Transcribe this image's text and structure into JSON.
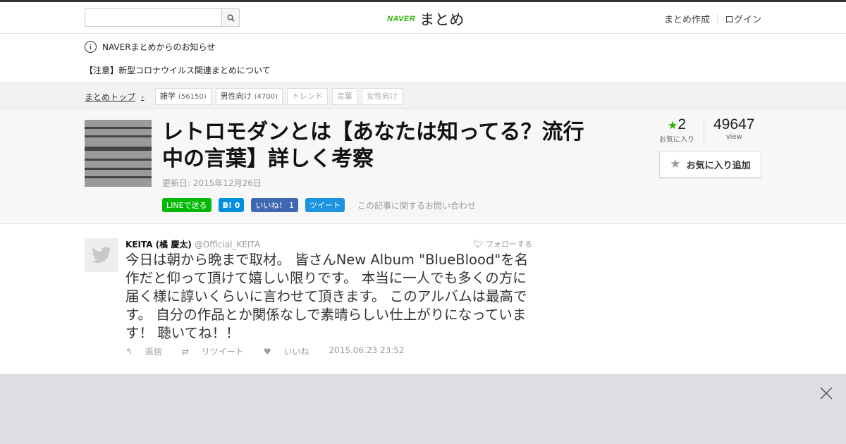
{
  "header": {
    "search_placeholder": "",
    "logo_brand": "NAVER",
    "logo_service": "まとめ",
    "nav": [
      "まとめ作成",
      "ログイン"
    ]
  },
  "notice": {
    "title": "NAVERまとめからのお知らせ",
    "item": "【注意】新型コロナウイルス関連まとめについて"
  },
  "breadcrumb": {
    "top": "まとめトップ",
    "tags": [
      {
        "label": "雑学",
        "count": "(56150)"
      },
      {
        "label": "男性向け",
        "count": "(4700)"
      },
      {
        "label": "トレンド",
        "count": ""
      },
      {
        "label": "言葉",
        "count": ""
      },
      {
        "label": "女性向け",
        "count": ""
      }
    ]
  },
  "article": {
    "title": "レトロモダンとは【あなたは知ってる？流行中の言葉】詳しく考察",
    "updated": "更新日: 2015年12月26日",
    "social": {
      "line": "LINEで送る",
      "hatena": "B! 0",
      "fb": "いいね！ 1",
      "tweet": "ツイート"
    },
    "inquiry": "この記事に関するお問い合わせ",
    "favorites": "2",
    "favorites_label": "お気に入り",
    "views": "49647",
    "views_label": "view",
    "fav_button": "お気に入り追加"
  },
  "tweet": {
    "name": "KEITA (橘 慶太)",
    "handle": "@Official_KEITA",
    "follow": "フォローする",
    "text": "今日は朝から晩まで取材。 皆さんNew Album \"BlueBlood\"を名作だと仰って頂けて嬉しい限りです。 本当に一人でも多くの方に届く様に諄いくらいに言わせて頂きます。 このアルバムは最高です。 自分の作品とか関係なしで素晴らしい仕上がりになっています！ 聴いてね！！",
    "reply": "返信",
    "retweet": "リツイート",
    "like": "いいね",
    "date": "2015.06.23 23:52"
  },
  "colors": {
    "accent": "#2db400",
    "line": "#00b900",
    "hatena": "#008fde",
    "fb": "#4267b2",
    "twitter": "#1b95e0"
  }
}
